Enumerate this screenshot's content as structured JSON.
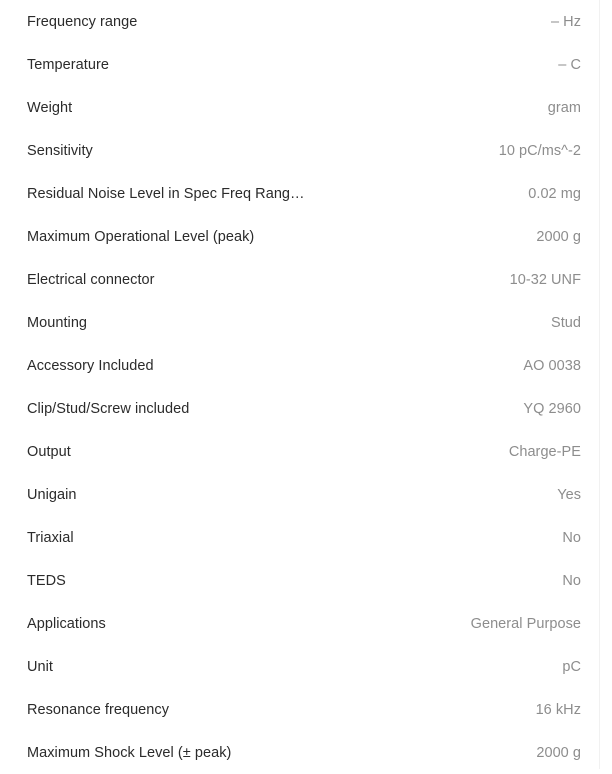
{
  "spec_table": {
    "label_color": "#2b2b2b",
    "value_color": "#8d8d8d",
    "background_color": "#ffffff",
    "rows": [
      {
        "label": "Frequency range",
        "value": "– Hz"
      },
      {
        "label": "Temperature",
        "value": "– C"
      },
      {
        "label": "Weight",
        "value": "gram"
      },
      {
        "label": "Sensitivity",
        "value": "10 pC/ms^-2"
      },
      {
        "label": "Residual Noise Level in Spec Freq Rang…",
        "value": "0.02 mg"
      },
      {
        "label": "Maximum Operational Level (peak)",
        "value": "2000 g"
      },
      {
        "label": "Electrical connector",
        "value": "10-32 UNF"
      },
      {
        "label": "Mounting",
        "value": "Stud"
      },
      {
        "label": "Accessory Included",
        "value": "AO 0038"
      },
      {
        "label": "Clip/Stud/Screw included",
        "value": "YQ 2960"
      },
      {
        "label": "Output",
        "value": "Charge-PE"
      },
      {
        "label": "Unigain",
        "value": "Yes"
      },
      {
        "label": "Triaxial",
        "value": "No"
      },
      {
        "label": "TEDS",
        "value": "No"
      },
      {
        "label": "Applications",
        "value": "General Purpose"
      },
      {
        "label": "Unit",
        "value": "pC"
      },
      {
        "label": "Resonance frequency",
        "value": "16 kHz"
      },
      {
        "label": "Maximum Shock Level (± peak)",
        "value": "2000 g"
      }
    ]
  }
}
